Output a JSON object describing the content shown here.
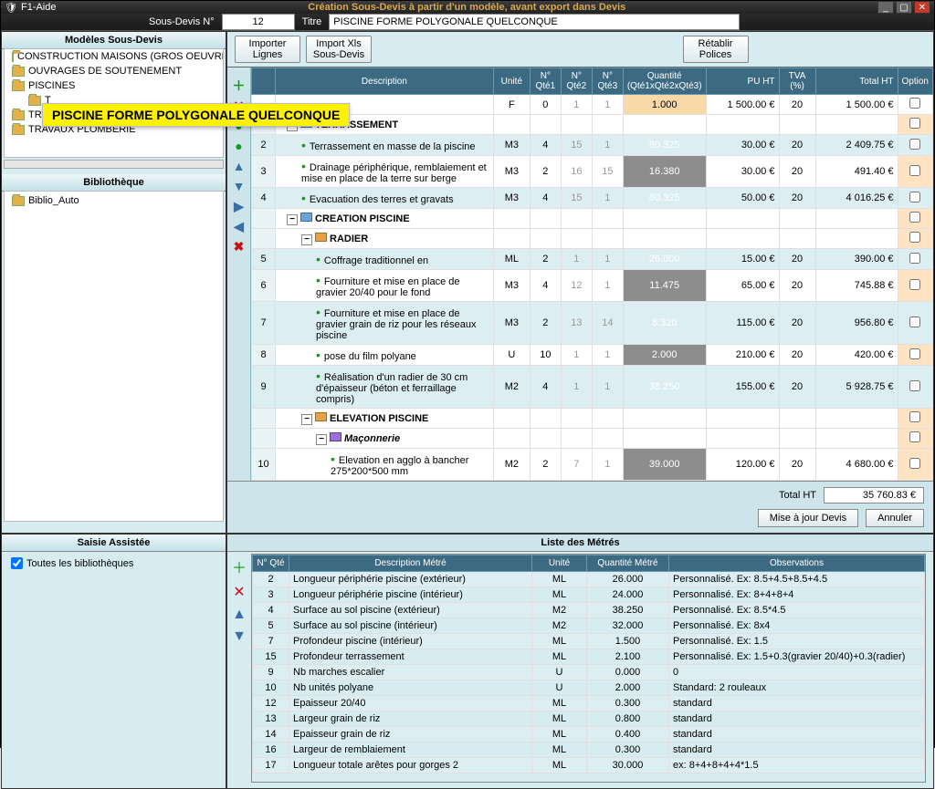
{
  "window": {
    "title_left": "F1-Aide",
    "title_center": "Création Sous-Devis à partir d'un modèle, avant export dans Devis"
  },
  "header": {
    "sousdevis_label": "Sous-Devis N°",
    "sousdevis_num": "12",
    "titre_label": "Titre",
    "titre_value": "PISCINE FORME POLYGONALE QUELCONQUE"
  },
  "tree_panel": {
    "title": "Modèles Sous-Devis"
  },
  "tree_items": [
    "CONSTRUCTION MAISONS (GROS OEUVRE)",
    "OUVRAGES DE SOUTENEMENT",
    "PISCINES",
    "TRAVAUX ELECTRICITE",
    "TRAVAUX PLOMBERIE"
  ],
  "highlight_text": "PISCINE FORME POLYGONALE QUELCONQUE",
  "biblio": {
    "title": "Bibliothèque",
    "item": "Biblio_Auto"
  },
  "saisie": {
    "title": "Saisie Assistée",
    "check": "Toutes les bibliothèques"
  },
  "toolbar": {
    "importer_l1": "Importer",
    "importer_l2": "Lignes",
    "importxls_l1": "Import Xls",
    "importxls_l2": "Sous-Devis",
    "retablir_l1": "Rétablir",
    "retablir_l2": "Polices"
  },
  "columns": {
    "desc": "Description",
    "unite": "Unité",
    "q1": "N° Qté1",
    "q2": "N° Qté2",
    "q3": "N° Qté3",
    "qty": "Quantité (Qté1xQté2xQté3)",
    "pu": "PU HT",
    "tva": "TVA (%)",
    "tot": "Total HT",
    "opt": "Option"
  },
  "top_row": {
    "unit": "F",
    "q1": "0",
    "q2": "1",
    "q3": "1",
    "qty": "1.000",
    "pu": "1 500.00 €",
    "tva": "20",
    "tot": "1 500.00 €"
  },
  "groups": {
    "terrassement": "TERRASSEMENT",
    "creation": "CREATION PISCINE",
    "radier": "RADIER",
    "elevation": "ELEVATION PISCINE",
    "maconnerie": "Maçonnerie"
  },
  "rows": [
    {
      "n": "2",
      "desc": "Terrassement en masse de la piscine",
      "u": "M3",
      "q1": "4",
      "q2": "15",
      "q3": "1",
      "qty": "80.325",
      "pu": "30.00 €",
      "tva": "20",
      "tot": "2 409.75 €"
    },
    {
      "n": "3",
      "desc": "Drainage périphérique, remblaiement et mise en place de la terre sur berge",
      "u": "M3",
      "q1": "2",
      "q2": "16",
      "q3": "15",
      "qty": "16.380",
      "pu": "30.00 €",
      "tva": "20",
      "tot": "491.40 €"
    },
    {
      "n": "4",
      "desc": "Evacuation des terres et gravats",
      "u": "M3",
      "q1": "4",
      "q2": "15",
      "q3": "1",
      "qty": "80.325",
      "pu": "50.00 €",
      "tva": "20",
      "tot": "4 016.25 €"
    },
    {
      "n": "5",
      "desc": "Coffrage traditionnel en",
      "u": "ML",
      "q1": "2",
      "q2": "1",
      "q3": "1",
      "qty": "26.000",
      "pu": "15.00 €",
      "tva": "20",
      "tot": "390.00 €"
    },
    {
      "n": "6",
      "desc": "Fourniture et mise en place de gravier 20/40 pour le fond",
      "u": "M3",
      "q1": "4",
      "q2": "12",
      "q3": "1",
      "qty": "11.475",
      "pu": "65.00 €",
      "tva": "20",
      "tot": "745.88 €"
    },
    {
      "n": "7",
      "desc": "Fourniture et mise en place de gravier grain de riz pour les réseaux piscine",
      "u": "M3",
      "q1": "2",
      "q2": "13",
      "q3": "14",
      "qty": "8.320",
      "pu": "115.00 €",
      "tva": "20",
      "tot": "956.80 €"
    },
    {
      "n": "8",
      "desc": "pose du film polyane",
      "u": "U",
      "q1": "10",
      "q2": "1",
      "q3": "1",
      "qty": "2.000",
      "pu": "210.00 €",
      "tva": "20",
      "tot": "420.00 €"
    },
    {
      "n": "9",
      "desc": "Réalisation d'un radier de 30 cm d'épaisseur (béton et ferraillage compris)",
      "u": "M2",
      "q1": "4",
      "q2": "1",
      "q3": "1",
      "qty": "38.250",
      "pu": "155.00 €",
      "tva": "20",
      "tot": "5 928.75 €"
    },
    {
      "n": "10",
      "desc": "Elevation en agglo à bancher 275*200*500 mm",
      "u": "M2",
      "q1": "2",
      "q2": "7",
      "q3": "1",
      "qty": "39.000",
      "pu": "120.00 €",
      "tva": "20",
      "tot": "4 680.00 €"
    }
  ],
  "footer": {
    "total_label": "Total HT",
    "total_value": "35 760.83 €",
    "maj": "Mise à jour Devis",
    "annuler": "Annuler"
  },
  "metres": {
    "title": "Liste des Métrés",
    "cols": {
      "n": "N° Qté",
      "desc": "Description Métré",
      "u": "Unité",
      "q": "Quantité Métré",
      "obs": "Observations"
    },
    "rows": [
      {
        "n": "2",
        "desc": "Longueur périphérie piscine (extérieur)",
        "u": "ML",
        "q": "26.000",
        "obs": "Personnalisé. Ex: 8.5+4.5+8.5+4.5"
      },
      {
        "n": "3",
        "desc": "Longueur périphérie piscine (intérieur)",
        "u": "ML",
        "q": "24.000",
        "obs": "Personnalisé. Ex: 8+4+8+4"
      },
      {
        "n": "4",
        "desc": "Surface au sol piscine (extérieur)",
        "u": "M2",
        "q": "38.250",
        "obs": "Personnalisé. Ex: 8.5*4.5"
      },
      {
        "n": "5",
        "desc": "Surface au sol piscine (intérieur)",
        "u": "M2",
        "q": "32.000",
        "obs": "Personnalisé. Ex: 8x4"
      },
      {
        "n": "7",
        "desc": "Profondeur piscine (intérieur)",
        "u": "ML",
        "q": "1.500",
        "obs": "Personnalisé. Ex: 1.5"
      },
      {
        "n": "15",
        "desc": "Profondeur terrassement",
        "u": "ML",
        "q": "2.100",
        "obs": "Personnalisé. Ex: 1.5+0.3(gravier 20/40)+0.3(radier)"
      },
      {
        "n": "9",
        "desc": "Nb marches escalier",
        "u": "U",
        "q": "0.000",
        "obs": "0"
      },
      {
        "n": "10",
        "desc": "Nb unités polyane",
        "u": "U",
        "q": "2.000",
        "obs": "Standard: 2 rouleaux"
      },
      {
        "n": "12",
        "desc": "Epaisseur 20/40",
        "u": "ML",
        "q": "0.300",
        "obs": "standard"
      },
      {
        "n": "13",
        "desc": "Largeur grain de riz",
        "u": "ML",
        "q": "0.800",
        "obs": "standard"
      },
      {
        "n": "14",
        "desc": "Epaisseur grain de riz",
        "u": "ML",
        "q": "0.400",
        "obs": "standard"
      },
      {
        "n": "16",
        "desc": "Largeur de remblaiement",
        "u": "ML",
        "q": "0.300",
        "obs": "standard"
      },
      {
        "n": "17",
        "desc": "Longueur totale arêtes pour gorges 2",
        "u": "ML",
        "q": "30.000",
        "obs": "ex: 8+4+8+4+4*1.5"
      }
    ]
  }
}
